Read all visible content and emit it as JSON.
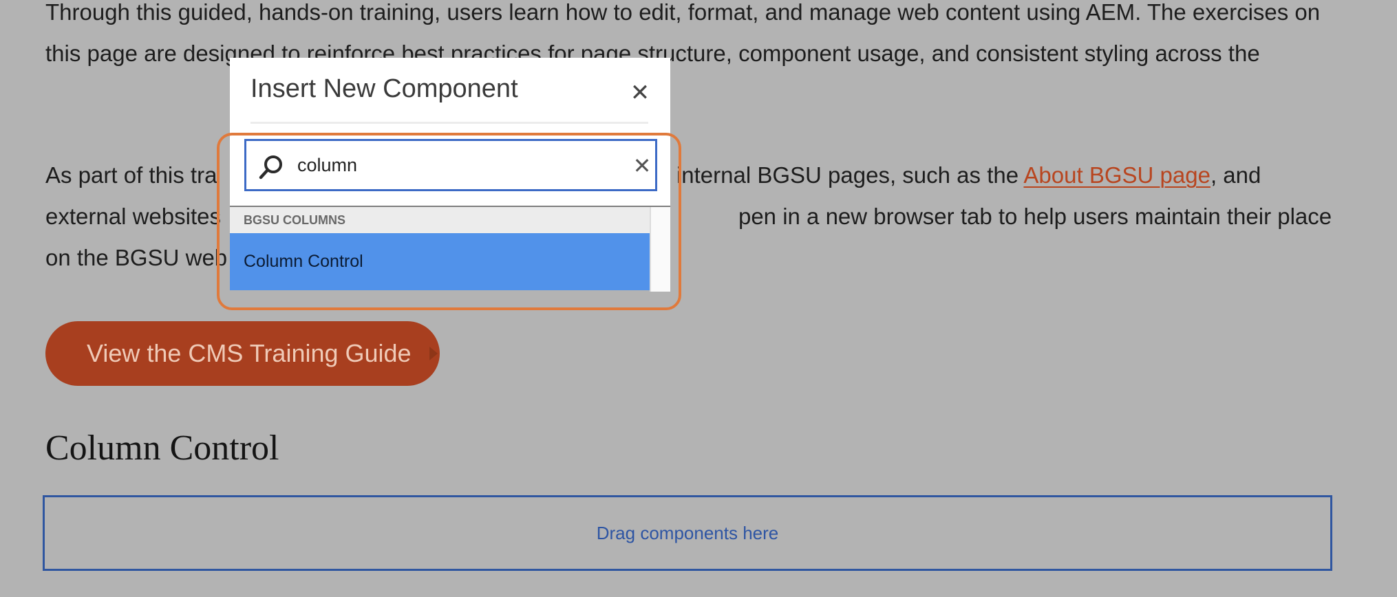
{
  "page": {
    "para1": "Through this guided, hands-on training, users learn how to edit, format, and manage web content using AEM. The exercises on this page are designed to reinforce best practices for page structure, component usage, and consistent styling across the",
    "para2_before_link": "As part of this tra",
    "para2_visible_mid": "n internal BGSU pages, such as the ",
    "para2_link": "About BGSU page",
    "para2_after_link": ", and",
    "para2_line2_start": "external websites",
    "para2_line2_end": "pen in a new browser tab to help users maintain their place",
    "para2_line3": "on the BGSU web",
    "cta_label": "View the CMS Training Guide",
    "heading": "Column Control",
    "dropzone_label": "Drag components here"
  },
  "dialog": {
    "title": "Insert New Component",
    "close_icon": "close-icon",
    "search": {
      "value": "column",
      "placeholder": "",
      "icon": "search-icon",
      "clear_icon": "clear-icon"
    },
    "results": {
      "group": "BGSU COLUMNS",
      "items": [
        "Column Control"
      ],
      "selected_index": 0
    }
  },
  "colors": {
    "overlay": "#b3b3b3",
    "link": "#b8451f",
    "cta_bg": "#a83f1f",
    "selection": "#5192ea",
    "focus_border": "#3c6ac5",
    "highlight": "#e07a3c",
    "dropzone_border": "#2f56a0"
  }
}
